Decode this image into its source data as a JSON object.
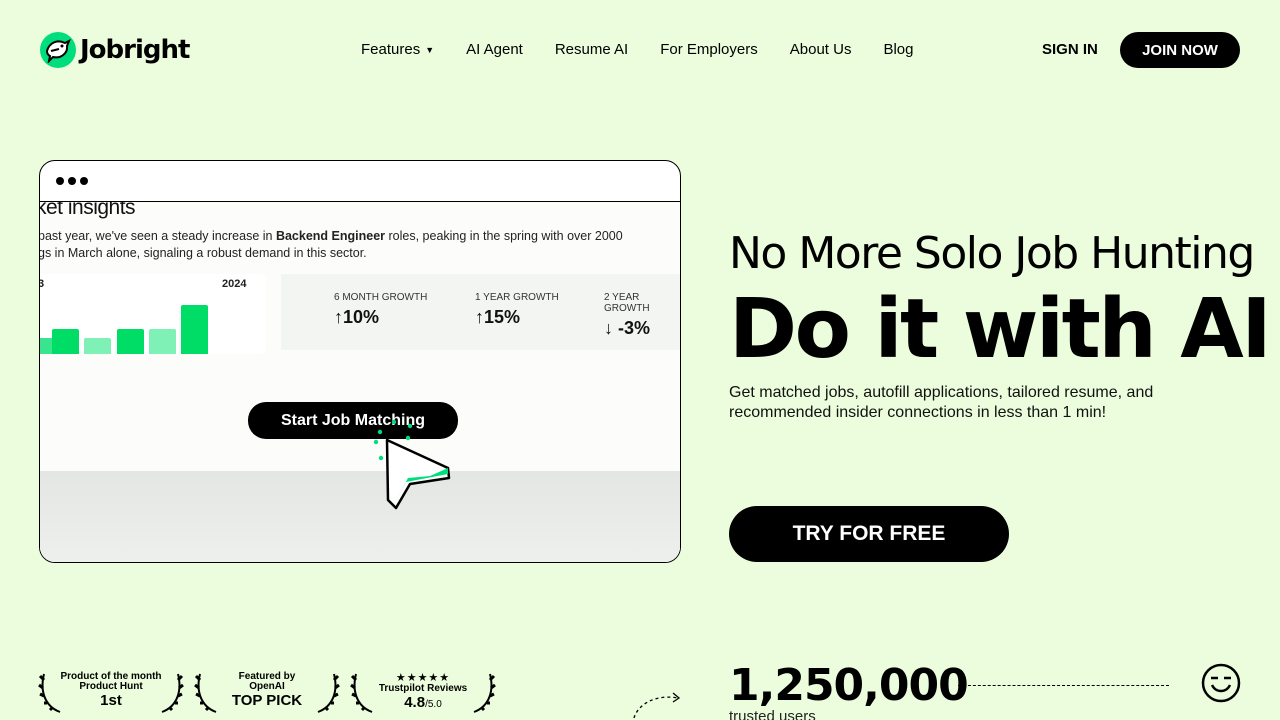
{
  "brand": {
    "name": "Jobright",
    "accent": "#00dd7d",
    "background": "#ebfddc"
  },
  "nav": {
    "items": [
      {
        "label": "Features",
        "has_dropdown": true
      },
      {
        "label": "AI Agent"
      },
      {
        "label": "Resume AI"
      },
      {
        "label": "For Employers"
      },
      {
        "label": "About Us"
      },
      {
        "label": "Blog"
      }
    ],
    "sign_in": "SIGN IN",
    "join_now": "JOIN NOW"
  },
  "demo": {
    "insights_title": "ket insights",
    "insights_text_pre": "past year, we've seen a steady increase in ",
    "insights_text_bold": "Backend Engineer",
    "insights_text_mid": " roles, peaking in the spring with over 2000",
    "insights_text_line2": "gs in March alone, signaling a robust demand in this sector.",
    "chart_left_label": "3",
    "chart_right_label": "2024",
    "stats": [
      {
        "label": "6 MONTH GROWTH",
        "value": "10%",
        "direction": "up"
      },
      {
        "label": "1 YEAR GROWTH",
        "value": "15%",
        "direction": "up"
      },
      {
        "label": "2 YEAR GROWTH",
        "value": "-3%",
        "direction": "down"
      }
    ],
    "start_button": "Start Job Matching"
  },
  "hero": {
    "subtitle": "No More Solo Job Hunting",
    "title": "Do it with AI",
    "description": "Get matched jobs, autofill applications, tailored resume, and recommended insider connections in less than 1 min!",
    "cta": "TRY FOR FREE"
  },
  "badges": [
    {
      "line1": "Product of the month",
      "line2": "Product Hunt",
      "big": "1st"
    },
    {
      "line1": "Featured by",
      "line2": "OpenAI",
      "big": "TOP PICK"
    },
    {
      "stars": "★★★★★",
      "line2": "Trustpilot Reviews",
      "big": "4.8",
      "suffix": "/5.0"
    }
  ],
  "stats": {
    "count": "1,250,000",
    "label": "trusted users"
  }
}
